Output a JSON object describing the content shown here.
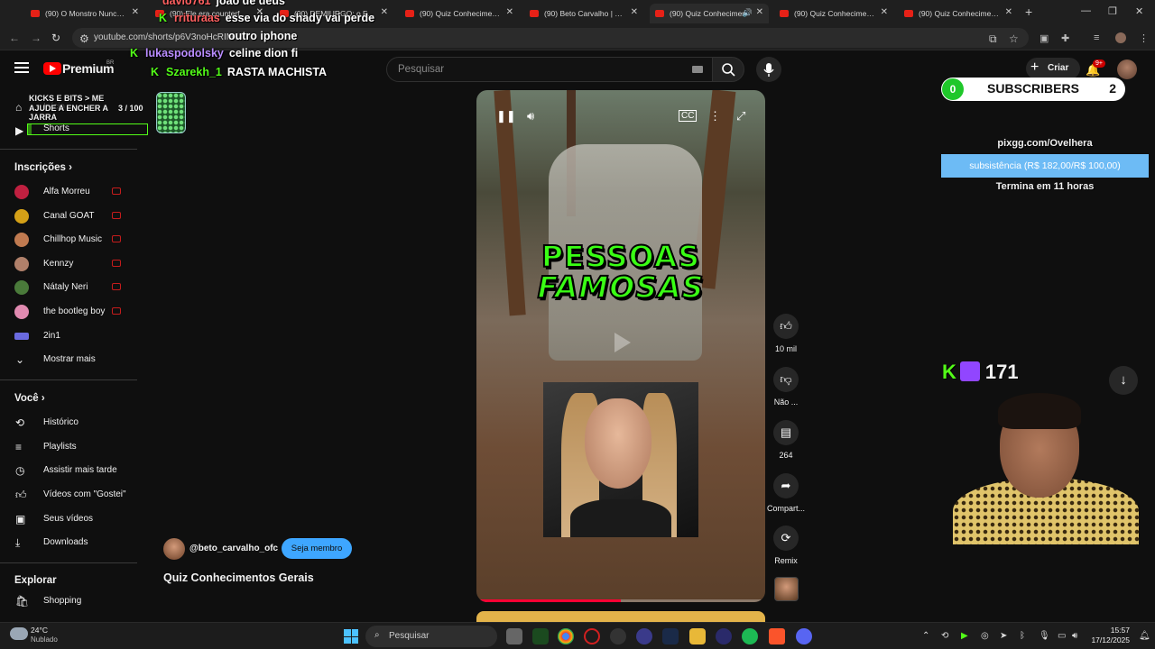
{
  "browser": {
    "tabs": [
      {
        "label": "(90) O Monstro Nunca Es"
      },
      {
        "label": "(90) Ele era counterf #de"
      },
      {
        "label": "(90) DEMIURGO: o FALSO"
      },
      {
        "label": "(90) Quiz Conhecimentos"
      },
      {
        "label": "(90) Beto Carvalho | Conh"
      },
      {
        "label": "(90) Quiz Conhecimen"
      },
      {
        "label": "(90) Quiz Conhecimentos"
      },
      {
        "label": "(90) Quiz Conhecimentos"
      }
    ],
    "url": "youtube.com/shorts/p6V3noHcRIM"
  },
  "chat": [
    {
      "user": "davio761",
      "msg": "joao de deus"
    },
    {
      "user": "rrituraas",
      "msg": "esse via do shady vai perde"
    },
    {
      "user": "",
      "msg": "outro iphone"
    },
    {
      "user": "lukaspodolsky",
      "msg": "celine dion fi"
    },
    {
      "user": "Szarekh_1",
      "msg": "RASTA MACHISTA"
    }
  ],
  "header": {
    "brand": "Premium",
    "region": "BR",
    "search_placeholder": "Pesquisar",
    "create_label": "Criar",
    "notif_badge": "9+"
  },
  "goal": {
    "text": "KICKS E BITS > ME AJUDE A ENCHER A JARRA",
    "count": "3 / 100",
    "progress": 0.03
  },
  "sidebar": {
    "top": [
      {
        "label": "Início"
      },
      {
        "label": "Shorts"
      }
    ],
    "subs_heading": "Inscrições",
    "subscriptions": [
      {
        "label": "Alfa Morreu",
        "color": "#c02040"
      },
      {
        "label": "Canal GOAT",
        "color": "#d4a017"
      },
      {
        "label": "Chillhop Music",
        "color": "#c07a50"
      },
      {
        "label": "Kennzy",
        "color": "#b0806a"
      },
      {
        "label": "Nátaly Neri",
        "color": "#4a7a3a"
      },
      {
        "label": "the bootleg boy",
        "color": "#e08ab0"
      },
      {
        "label": "2in1",
        "color": "#6a6ae0"
      }
    ],
    "show_more": "Mostrar mais",
    "you_heading": "Você",
    "you_items": [
      {
        "label": "Histórico",
        "icon": "history-icon"
      },
      {
        "label": "Playlists",
        "icon": "playlists-icon"
      },
      {
        "label": "Assistir mais tarde",
        "icon": "watch-later-icon"
      },
      {
        "label": "Vídeos com \"Gostei\"",
        "icon": "liked-icon"
      },
      {
        "label": "Seus vídeos",
        "icon": "your-videos-icon"
      },
      {
        "label": "Downloads",
        "icon": "downloads-icon"
      }
    ],
    "explore_heading": "Explorar",
    "explore_items": [
      {
        "label": "Shopping"
      }
    ]
  },
  "video": {
    "caption_line1": "PESSOAS",
    "caption_line2": "FAMOSAS",
    "progress": 0.5
  },
  "actions": {
    "likes": "10 mil",
    "dislike": "Não ...",
    "comments": "264",
    "share": "Compart...",
    "remix": "Remix"
  },
  "channel": {
    "handle": "@beto_carvalho_ofc",
    "member_button": "Seja membro",
    "title": "Quiz Conhecimentos Gerais"
  },
  "stream": {
    "subs_left": "0",
    "subs_label": "SUBSCRIBERS",
    "subs_right": "2",
    "pix_url": "pixgg.com/Ovelhera",
    "pix_text": "subsistência (R$ 182,00/R$ 100,00)",
    "pix_progress": 1.0,
    "pix_end": "Termina em 11 horas",
    "viewers": "171"
  },
  "taskbar": {
    "temp": "24°C",
    "condition": "Nublado",
    "search_label": "Pesquisar",
    "time": "15:57",
    "date": "17/12/2025"
  }
}
